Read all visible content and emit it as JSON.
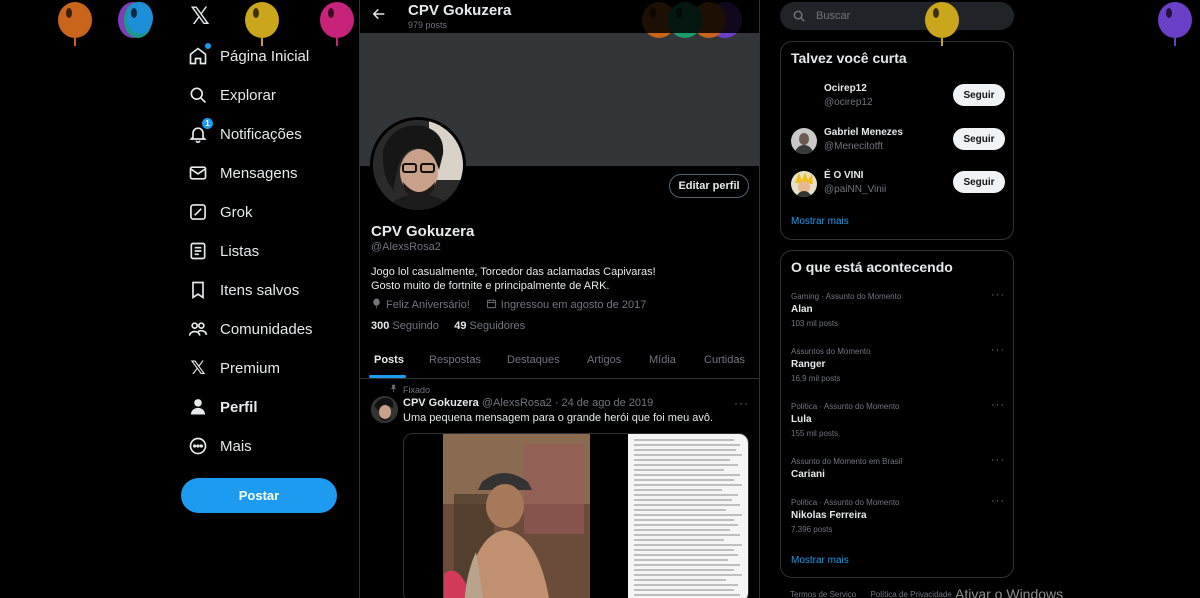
{
  "nav": {
    "items": [
      {
        "label": "Página Inicial",
        "icon": "home-icon"
      },
      {
        "label": "Explorar",
        "icon": "search-icon"
      },
      {
        "label": "Notificações",
        "icon": "bell-icon",
        "badge": "1"
      },
      {
        "label": "Mensagens",
        "icon": "mail-icon"
      },
      {
        "label": "Grok",
        "icon": "grok-icon"
      },
      {
        "label": "Listas",
        "icon": "list-icon"
      },
      {
        "label": "Itens salvos",
        "icon": "bookmark-icon"
      },
      {
        "label": "Comunidades",
        "icon": "communities-icon"
      },
      {
        "label": "Premium",
        "icon": "x-logo-icon"
      },
      {
        "label": "Perfil",
        "icon": "person-icon"
      },
      {
        "label": "Mais",
        "icon": "more-icon"
      }
    ],
    "post_label": "Postar"
  },
  "profile": {
    "name": "CPV Gokuzera",
    "post_count": "979 posts",
    "handle": "@AlexsRosa2",
    "edit_label": "Editar perfil",
    "bio_line1": "Jogo lol casualmente,  Torcedor das aclamadas Capivaras!",
    "bio_line2": "Gosto muito de fortnite e principalmente de ARK.",
    "birthday": "Feliz Aniversário!",
    "joined": "Ingressou em agosto de 2017",
    "following_count": "300",
    "following_label": "Seguindo",
    "followers_count": "49",
    "followers_label": "Seguidores"
  },
  "tabs": [
    "Posts",
    "Respostas",
    "Destaques",
    "Artigos",
    "Mídia",
    "Curtidas"
  ],
  "tweet": {
    "pinned_label": "Fixado",
    "author": "CPV Gokuzera",
    "handle_date": "@AlexsRosa2 · 24 de ago de 2019",
    "text": "Uma pequena mensagem para o grande herói que foi meu avô."
  },
  "search": {
    "placeholder": "Buscar"
  },
  "who_to_follow": {
    "title": "Talvez você curta",
    "users": [
      {
        "name": "Ocirep12",
        "handle": "@ocirep12",
        "button": "Seguir"
      },
      {
        "name": "Gabriel Menezes",
        "handle": "@Menecitotft",
        "button": "Seguir"
      },
      {
        "name": "É O VINI",
        "handle": "@paiNN_Vinii",
        "button": "Seguir"
      }
    ],
    "show_more": "Mostrar mais"
  },
  "trends": {
    "title": "O que está acontecendo",
    "items": [
      {
        "context": "Gaming · Assunto do Momento",
        "topic": "Alan",
        "posts": "103 mil posts"
      },
      {
        "context": "Assuntos do Momento",
        "topic": "Ranger",
        "posts": "16,9 mil posts"
      },
      {
        "context": "Política · Assunto do Momento",
        "topic": "Lula",
        "posts": "155 mil posts"
      },
      {
        "context": "Assunto do Momento em Brasil",
        "topic": "Cariani",
        "posts": ""
      },
      {
        "context": "Política · Assunto do Momento",
        "topic": "Nikolas Ferreira",
        "posts": "7.396 posts"
      }
    ],
    "show_more": "Mostrar mais"
  },
  "footer": {
    "terms": "Termos de Serviço",
    "privacy": "Política de Privacidade"
  },
  "watermark": "Ativar o Windows",
  "colors": {
    "accent": "#1d9bf0",
    "background": "#000000",
    "border": "#2f3336",
    "muted": "#71767b"
  }
}
